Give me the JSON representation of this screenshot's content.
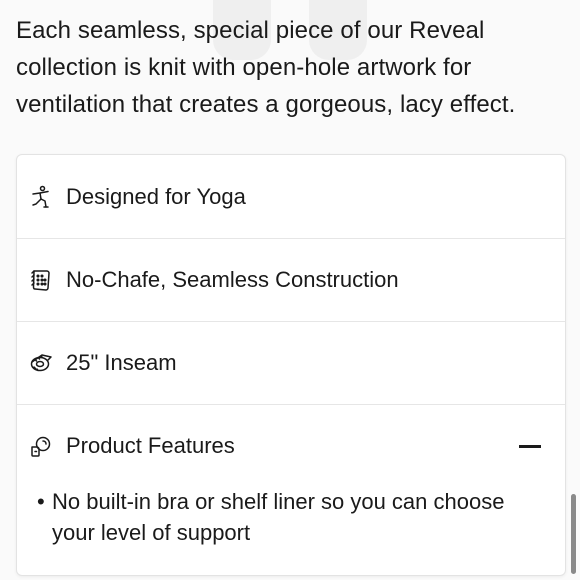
{
  "description": "Each seamless, special piece of our Reveal collection is knit with open-hole artwork for ventilation that creates a gorgeous, lacy effect.",
  "details": [
    {
      "icon": "yoga-pose-icon",
      "label": "Designed for Yoga"
    },
    {
      "icon": "fabric-swatch-icon",
      "label": "No-Chafe, Seamless Construction"
    },
    {
      "icon": "tape-measure-icon",
      "label": "25\" Inseam"
    },
    {
      "icon": "features-icon",
      "label": "Product Features",
      "expanded": true
    }
  ],
  "features": [
    "No built-in bra or shelf liner so you can choose your level of support"
  ],
  "colors": {
    "text": "#1a1a1a",
    "card_border": "#e3e3e3",
    "divider": "#e6e6e6",
    "background": "#fafafa"
  }
}
